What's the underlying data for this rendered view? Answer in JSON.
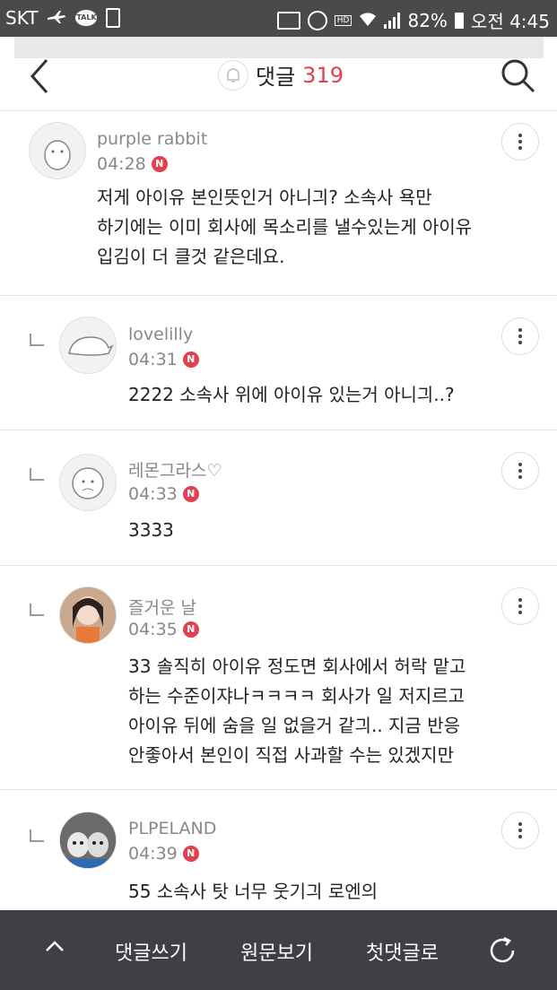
{
  "status_bar": {
    "carrier": "SKT",
    "talk_label": "TALK",
    "hd_label": "HD",
    "battery": "82%",
    "time": "오전 4:45"
  },
  "header": {
    "title": "댓글",
    "count": "319"
  },
  "comments": [
    {
      "nick": "purple rabbit",
      "time": "04:28",
      "badge": "N",
      "text": "저게 아이유 본인뜻인거 아니긔? 소속사 욕만\n하기에는 이미 회사에 목소리를 낼수있는게 아이유\n입김이 더 클것 같은데요."
    },
    {
      "nick": "lovelilly",
      "time": "04:31",
      "badge": "N",
      "text": "2222 소속사 위에 아이유 있는거 아니긔..?"
    },
    {
      "nick": "레몬그라스♡",
      "time": "04:33",
      "badge": "N",
      "text": "3333"
    },
    {
      "nick": "즐거운 날",
      "time": "04:35",
      "badge": "N",
      "text": "33 솔직히 아이유 정도면 회사에서 허락 맡고\n하는 수준이쟈나ㅋㅋㅋㅋ 회사가 일 저지르고\n아이유 뒤에 숨을 일 없을거 같긔.. 지금 반응\n안좋아서 본인이 직접 사과할 수는 있겠지만"
    },
    {
      "nick": "PLPELAND",
      "time": "04:39",
      "badge": "N",
      "text": "55 소속사 탓 너무 웃기긔 로엔의"
    }
  ],
  "bottom_bar": {
    "write": "댓글쓰기",
    "original": "원문보기",
    "first": "첫댓글로"
  },
  "icons": {
    "back": "chevron-left-icon",
    "bell": "bell-icon",
    "search": "search-icon",
    "more": "more-vertical-icon",
    "up": "chevron-up-icon",
    "refresh": "refresh-icon"
  },
  "colors": {
    "accent": "#e04050",
    "bottom_bar": "#3f3f46",
    "status_bar": "#4a4a4a"
  }
}
